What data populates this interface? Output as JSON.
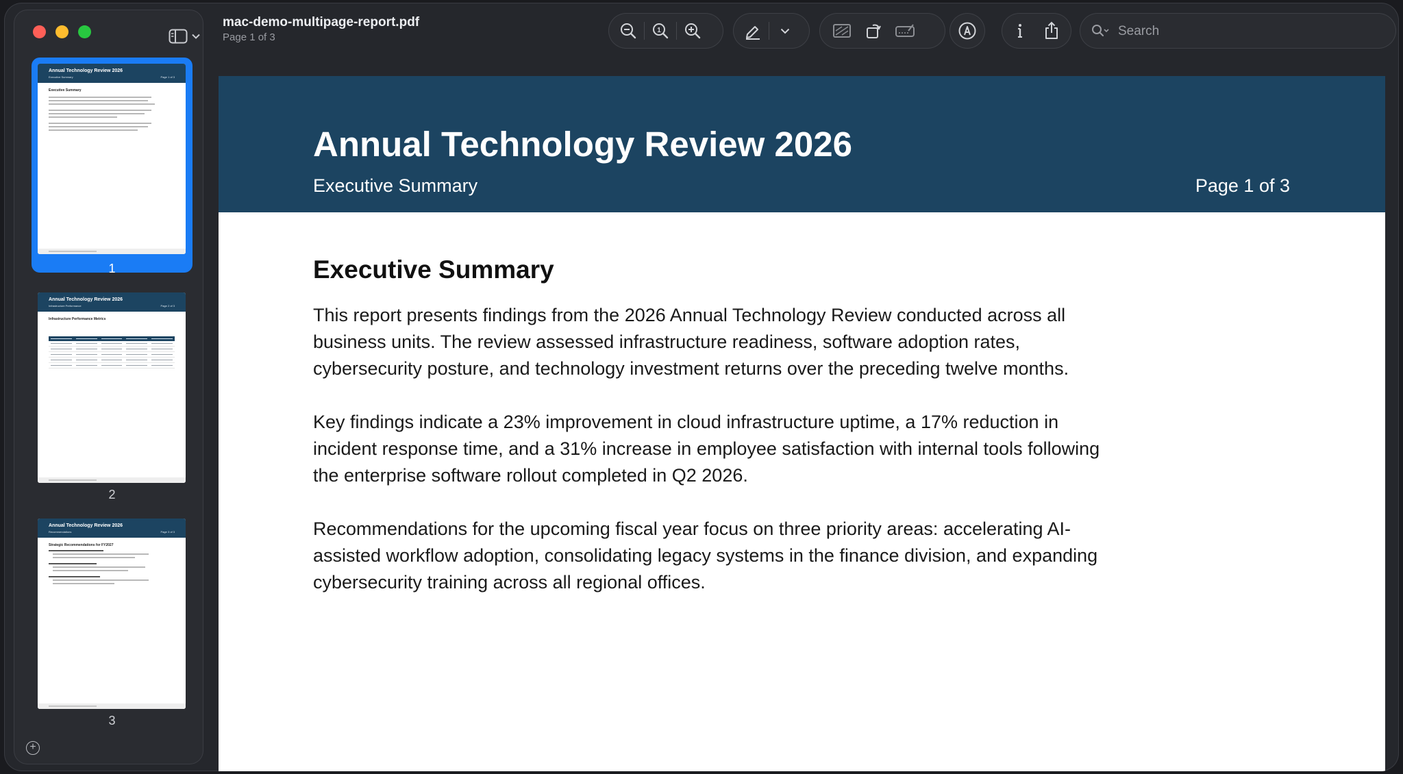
{
  "window": {
    "title": "mac-demo-multipage-report.pdf",
    "subtitle": "Page 1 of 3"
  },
  "toolbar": {
    "icons": [
      "zoom-out-icon",
      "actual-size-icon",
      "zoom-in-icon",
      "highlight-pen-icon",
      "chevron-down-icon",
      "crop-image-icon",
      "rotate-icon",
      "signature-icon",
      "markup-icon",
      "info-icon",
      "share-icon"
    ],
    "search_placeholder": "Search"
  },
  "sidebar": {
    "thumbnails": [
      {
        "number": "1",
        "selected": true,
        "title": "Annual Technology Review 2026",
        "subtitle": "Executive Summary",
        "page": "Page 1 of 3",
        "heading": "Executive Summary"
      },
      {
        "number": "2",
        "selected": false,
        "title": "Annual Technology Review 2026",
        "subtitle": "Infrastructure Performance",
        "page": "Page 2 of 3",
        "heading": "Infrastructure Performance Metrics"
      },
      {
        "number": "3",
        "selected": false,
        "title": "Annual Technology Review 2026",
        "subtitle": "Recommendations",
        "page": "Page 3 of 3",
        "heading": "Strategic Recommendations for FY2027"
      }
    ]
  },
  "document": {
    "header_title": "Annual Technology Review 2026",
    "header_subtitle": "Executive Summary",
    "header_page": "Page 1 of 3",
    "heading": "Executive Summary",
    "paragraphs": [
      "This report presents findings from the 2026 Annual Technology Review conducted across all business units. The review assessed infrastructure readiness, software adoption rates, cybersecurity posture, and technology investment returns over the preceding twelve months.",
      "Key findings indicate a 23% improvement in cloud infrastructure uptime, a 17% reduction in incident response time, and a 31% increase in employee satisfaction with internal tools following the enterprise software rollout completed in Q2 2026.",
      "Recommendations for the upcoming fiscal year focus on three priority areas: accelerating AI-assisted workflow adoption, consolidating legacy systems in the finance division, and expanding cybersecurity training across all regional offices."
    ]
  },
  "colors": {
    "accent": "#1a7cf5",
    "header_blue": "#1c4461"
  }
}
